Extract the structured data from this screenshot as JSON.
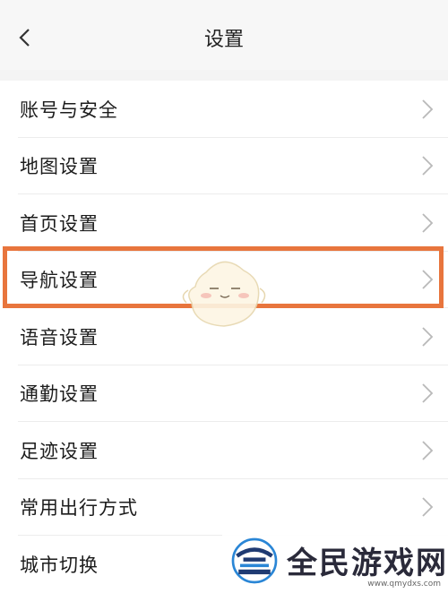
{
  "header": {
    "title": "设置",
    "back_icon": "chevron-left-icon"
  },
  "settings": {
    "items": [
      {
        "label": "账号与安全"
      },
      {
        "label": "地图设置"
      },
      {
        "label": "首页设置"
      },
      {
        "label": "导航设置"
      },
      {
        "label": "语音设置"
      },
      {
        "label": "通勤设置"
      },
      {
        "label": "足迹设置"
      },
      {
        "label": "常用出行方式"
      },
      {
        "label": "城市切换"
      }
    ],
    "highlighted_index": 3
  },
  "watermark": {
    "text": "全民游戏网",
    "url": "www.qmydxs.com"
  },
  "colors": {
    "highlight": "#e8753d",
    "chevron": "#b9b9b9"
  }
}
